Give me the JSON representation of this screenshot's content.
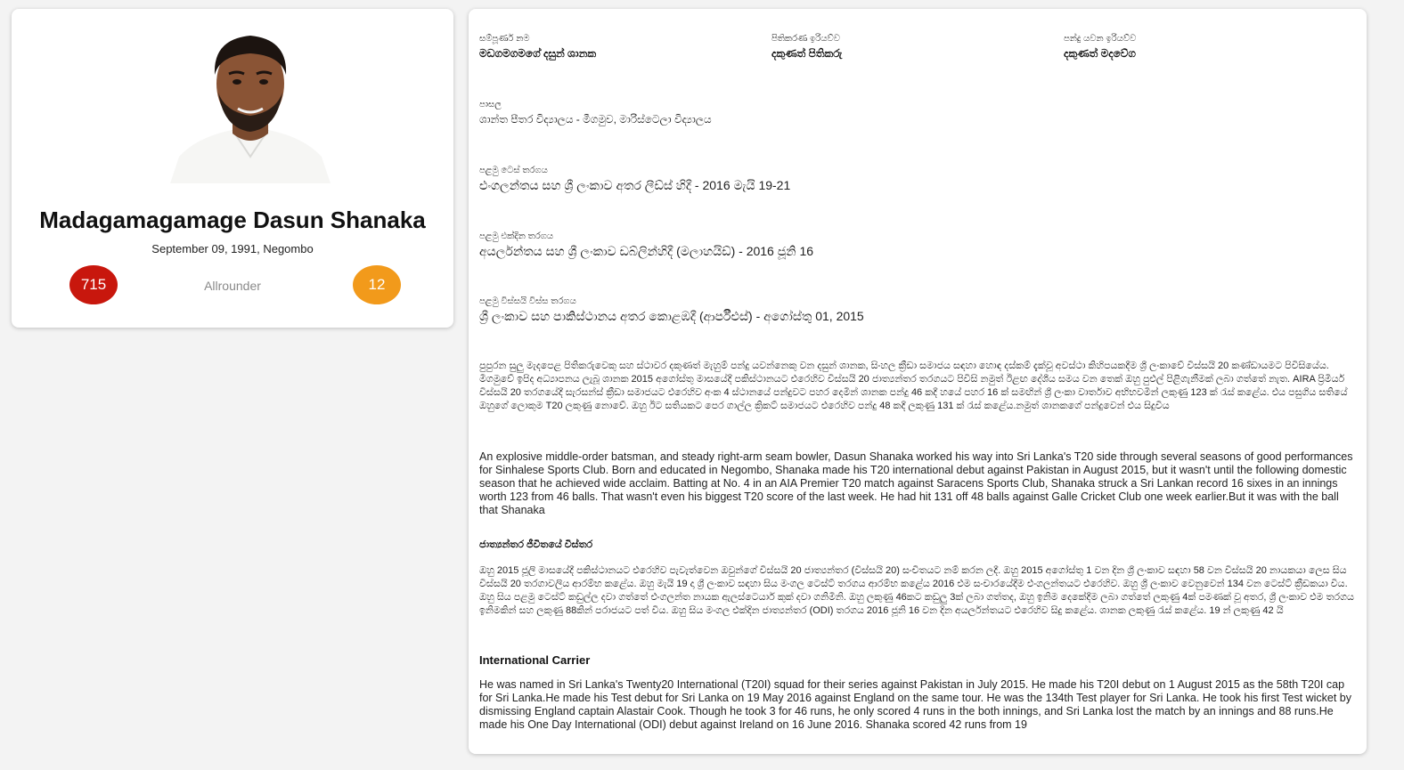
{
  "profile": {
    "name": "Madagamagamage Dasun Shanaka",
    "dob_place": "September 09, 1991, Negombo",
    "stat_left": "715",
    "stat_right": "12",
    "role": "Allrounder",
    "colors": {
      "stat_left_bg": "#c8170d",
      "stat_right_bg": "#f29a1b"
    }
  },
  "details": {
    "full_name_label": "සම්පූර්ණ නම",
    "full_name_value": "මඩගමගමගේ දසුන් ශානක",
    "batting_label": "පිතිකරණ ඉරියව්ව",
    "batting_value": "දකුණත් පිතිකරු",
    "bowling_label": "පන්දු යවන ඉරියව්ව",
    "bowling_value": "දකුණත් මදවේග",
    "school_label": "පාසල",
    "school_value": "ශාන්ත පීතර විද්‍යාලය - මීගමුව, මාරිස්ටෙලා විද්‍යාලය",
    "first_test_label": "පළමු ටෙස් තරගය",
    "first_test_value": "එංගලන්තය සහ ශ්‍රී ලංකාව අතර ලීඩ්ස් හිදී - 2016 මැයි 19-21",
    "first_odi_label": "පළමු එක්දින තරගය",
    "first_odi_value": "අයර්ලන්තය සහ ශ්‍රී ලංකාව ඩබ්ලින්හිදී (මලාහයිඩ්) - 2016 ජූනි 16",
    "first_t20_label": "පළමු විස්සයි විස්ස තරගය",
    "first_t20_value": "ශ්‍රී ලංකාව සහ පාකිස්ථානය අතර කොළඹදී (ආර්පීඑස්) - අගෝස්තු 01, 2015",
    "bio_si": "පුපුරන සුලු මැදපෙළ පිතිකරුවෙකු සහ ස්ථාවර දකුණත් මැහුම් පන්දු යවන්නෙකු වන දසුන් ශානක, සිංහල ක්‍රීඩා සමාජය සඳහා හොඳ දස්කම් දැක්වූ අවස්ථා කිහිපයකදීම ශ්‍රී ලංකාවේ විස්සයි 20 කණ්ඩායමට පිවිසියේය. මීගමුවේ ඉපිද අධ්‍යාපනය ලැබූ ශානක 2015 අගෝස්තු මාසයේදී පකිස්ථානයට එරෙහිව විස්සයි 20 ජාත්‍යන්තර තරගයට පිවිසි නමුත් ඊළඟ දේශීය සමය වන තෙක් ඔහු පුළුල් පිළිගැනීමක් ලබා ගත්තේ නැත. AIRA ප්‍රිමියර් විස්සයි 20 තරගයේදී සැරසන්ස් ක්‍රීඩා සමාජයට එරෙහිව අංක 4 ස්ථානයේ පන්දුවට පහර දෙමින් ශානක පන්දු 46 කදී හයේ පහර 16 ක් සමඟින් ශ්‍රී ලංකා වාර්තාව අභිභවමින් ලකුණු 123 ක් රැස් කළේය. එය පසුගිය සතියේ ඔහුගේ ලොකුම T20 ලකුණු නොවේ. ඔහු ඊට සතියකට පෙර ගාල්ල ක්‍රිකට් සමාජයට එරෙහිව පන්දු 48 කදී ලකුණු 131 ක් රැස් කළේය.නමුත් ශානකගේ පන්දුවෙන් එය සිදුවිය",
    "bio_en": "An explosive middle-order batsman, and steady right-arm seam bowler, Dasun Shanaka worked his way into Sri Lanka's T20 side through several seasons of good performances for Sinhalese Sports Club. Born and educated in Negombo, Shanaka made his T20 international debut against Pakistan in August 2015, but it wasn't until the following domestic season that he achieved wide acclaim. Batting at No. 4 in an AIA Premier T20 match against Saracens Sports Club, Shanaka struck a Sri Lankan record 16 sixes in an innings worth 123 from 46 balls. That wasn't even his biggest T20 score of the last week. He had hit 131 off 48 balls against Galle Cricket Club one week earlier.But it was with the ball that Shanaka",
    "intl_title_si": "ජාත්‍යන්තර ජීවිතයේ විස්තර",
    "intl_si": "ඔහු 2015 ජූලි මාසයේදී පකිස්ථානයට එරෙහිව පැවැත්වෙන ඔවුන්ගේ විස්සයි 20 ජාත්‍යන්තර (විස්සයි 20) සංචිතයට නම් කරන ලදී. ඔහු 2015 අගෝස්තු 1 වන දින ශ්‍රී ලංකාව සඳහා 58 වන විස්සයි 20 නායකයා ලෙස සිය විස්සයි 20 තරගාවලිය ආරම්භ කළේය. ඔහු මැයි 19 දා ශ්‍රී ලංකාව සඳහා සිය මංගල ටෙස්ට් තරගය ආරම්භ කළේය 2016 එම සංචාරයේදීම එංගලන්තයට එරෙහිව. ඔහු ශ්‍රී ලංකාව වෙනුවෙන් 134 වන ටෙස්ට් ක්‍රීඩකයා විය. ඔහු සිය පළමු ටෙස්ට් කඩුල්ල දවා ගත්තේ එංගලන්ත නායක ඇලස්ටෙයාර් කුක් දවා ගනිමිනි. ඔහු ලකුණු 46කට කඩුලු 3ක් ලබා ගත්තද, ඔහු ඉනිම දෙකේදීම ලබා ගත්තේ ලකුණු 4ක් පමණක් වූ අතර, ශ්‍රී ලංකාව එම තරගය ඉනිමකින් සහ ලකුණු 88කින් පරාජයට පත් විය. ඔහු සිය මංගල එක්දින ජාත්‍යන්තර (ODI) තරගය 2016 ජූනි 16 වන දින අයර්ලන්තයට එරෙහිව සිදු කළේය. ශානක ලකුණු රැස් කළේය. 19 න් ලකුණු 42 යි",
    "intl_title_en": "International Carrier",
    "intl_en": "He was named in Sri Lanka's Twenty20 International (T20I) squad for their series against Pakistan in July 2015. He made his T20I debut on 1 August 2015 as the 58th T20I cap for Sri Lanka.He made his Test debut for Sri Lanka on 19 May 2016 against England on the same tour. He was the 134th Test player for Sri Lanka. He took his first Test wicket by dismissing England captain Alastair Cook. Though he took 3 for 46 runs, he only scored 4 runs in the both innings, and Sri Lanka lost the match by an innings and 88 runs.He made his One Day International (ODI) debut against Ireland on 16 June 2016. Shanaka scored 42 runs from 19"
  }
}
